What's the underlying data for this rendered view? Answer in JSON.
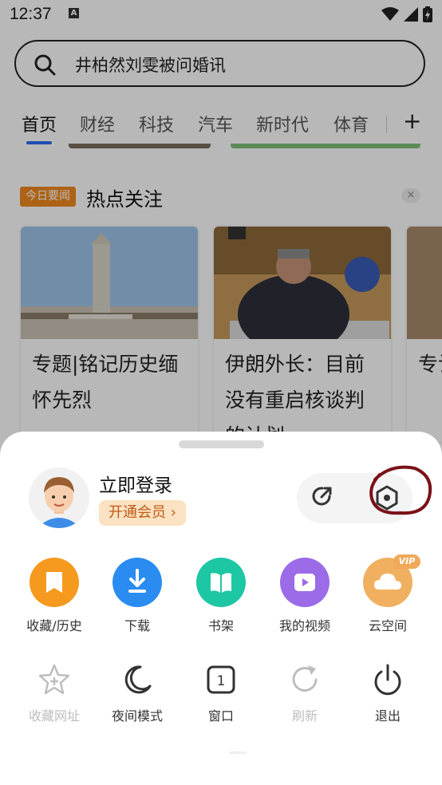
{
  "status_bar": {
    "time": "12:37",
    "notification_glyph": "A"
  },
  "search": {
    "text": "井柏然刘雯被问婚讯"
  },
  "tabs": [
    {
      "label": "首页",
      "active": true
    },
    {
      "label": "财经"
    },
    {
      "label": "科技"
    },
    {
      "label": "汽车"
    },
    {
      "label": "新时代"
    },
    {
      "label": "体育"
    }
  ],
  "tab_add": "+",
  "hot": {
    "badge": "今日要闻",
    "title": "热点关注",
    "close": "×"
  },
  "cards": [
    {
      "title": "专题|铭记历史缅怀先烈"
    },
    {
      "title": "伊朗外长：目前没有重启核谈判的计划"
    },
    {
      "title": "专计中"
    }
  ],
  "sheet": {
    "login": "立即登录",
    "vip": "开通会员 ›",
    "grid": [
      {
        "label": "收藏/历史",
        "color": "#f59a1e",
        "icon": "bookmark-icon"
      },
      {
        "label": "下载",
        "color": "#2a8cf0",
        "icon": "download-icon"
      },
      {
        "label": "书架",
        "color": "#1ec7a4",
        "icon": "book-icon"
      },
      {
        "label": "我的视频",
        "color": "#9b6be8",
        "icon": "video-icon"
      },
      {
        "label": "云空间",
        "color": "#f0b060",
        "icon": "cloud-icon",
        "tag": "VIP"
      }
    ],
    "row2": [
      {
        "label": "收藏网址",
        "dim": true,
        "icon": "star-add-icon"
      },
      {
        "label": "夜间模式",
        "icon": "moon-icon"
      },
      {
        "label": "窗口",
        "icon": "window-icon",
        "count": "1"
      },
      {
        "label": "刷新",
        "dim": true,
        "icon": "refresh-icon"
      },
      {
        "label": "退出",
        "icon": "power-icon"
      }
    ]
  }
}
